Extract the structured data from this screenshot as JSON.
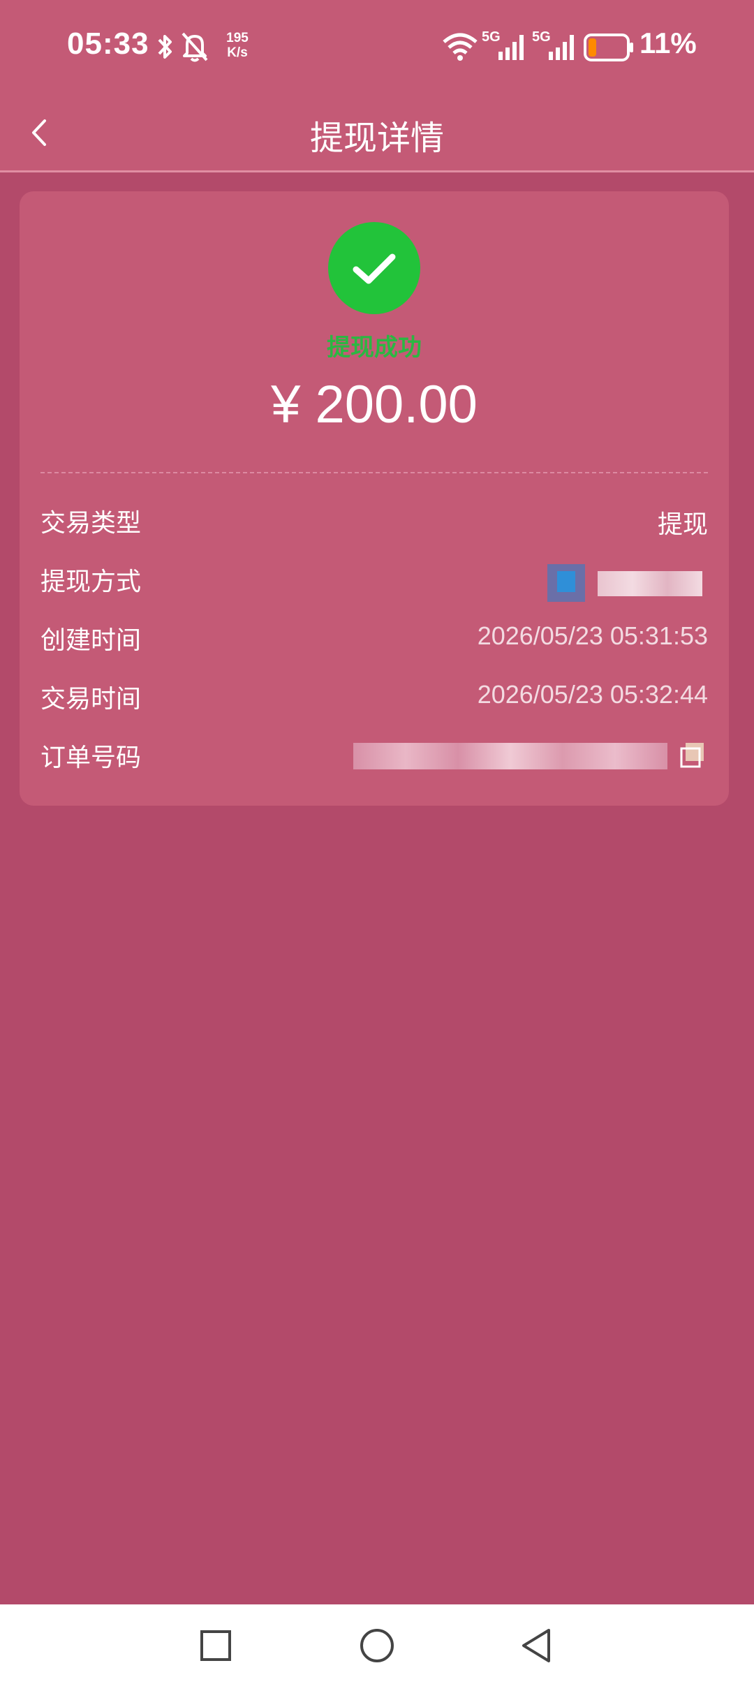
{
  "status_bar": {
    "time": "05:33",
    "net_speed_value": "195",
    "net_speed_unit": "K/s",
    "network_label_1": "5G",
    "network_label_2": "5G",
    "battery_percent": "11%",
    "battery_level": 0.11,
    "icons": [
      "bluetooth-icon",
      "mute-bell-icon",
      "wifi-icon",
      "cellular-signal-icon",
      "battery-icon"
    ]
  },
  "header": {
    "title": "提现详情",
    "back_icon": "chevron-left-icon"
  },
  "summary": {
    "status_icon": "check-circle-icon",
    "status_text": "提现成功",
    "amount": "¥ 200.00"
  },
  "details": [
    {
      "label": "交易类型",
      "value": "提现"
    },
    {
      "label": "提现方式",
      "value": ""
    },
    {
      "label": "创建时间",
      "value": "2026/05/23 05:31:53"
    },
    {
      "label": "交易时间",
      "value": "2026/05/23 05:32:44"
    },
    {
      "label": "订单号码",
      "value": ""
    }
  ],
  "nav_bar": {
    "icons": [
      "recents-square-icon",
      "home-circle-icon",
      "back-triangle-icon"
    ]
  },
  "colors": {
    "background": "#b34a6a",
    "header": "#c45a76",
    "card": "#c45a76",
    "success": "#22c33a",
    "success_text": "#2bb742"
  }
}
